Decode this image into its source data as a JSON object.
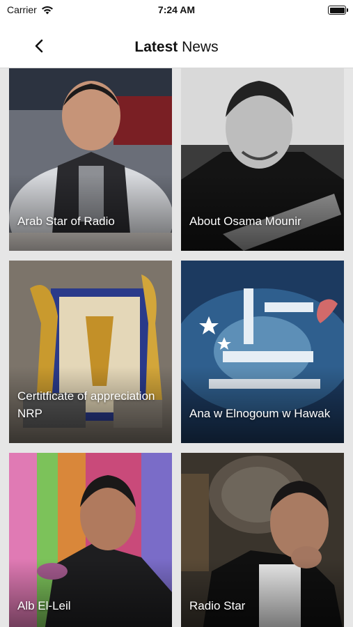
{
  "status_bar": {
    "carrier": "Carrier",
    "time": "7:24 AM",
    "icons": [
      "wifi-icon",
      "battery-icon"
    ]
  },
  "nav": {
    "back_icon": "chevron-left-icon",
    "title_bold": "Latest",
    "title_rest": " News"
  },
  "news": [
    {
      "title": "Arab Star of Radio"
    },
    {
      "title": "About Osama Mounir"
    },
    {
      "title": "Certitficate of appreciation NRP"
    },
    {
      "title": "Ana w Elnogoum w Hawak"
    },
    {
      "title": "Alb El-Leil"
    },
    {
      "title": "Radio Star"
    }
  ]
}
